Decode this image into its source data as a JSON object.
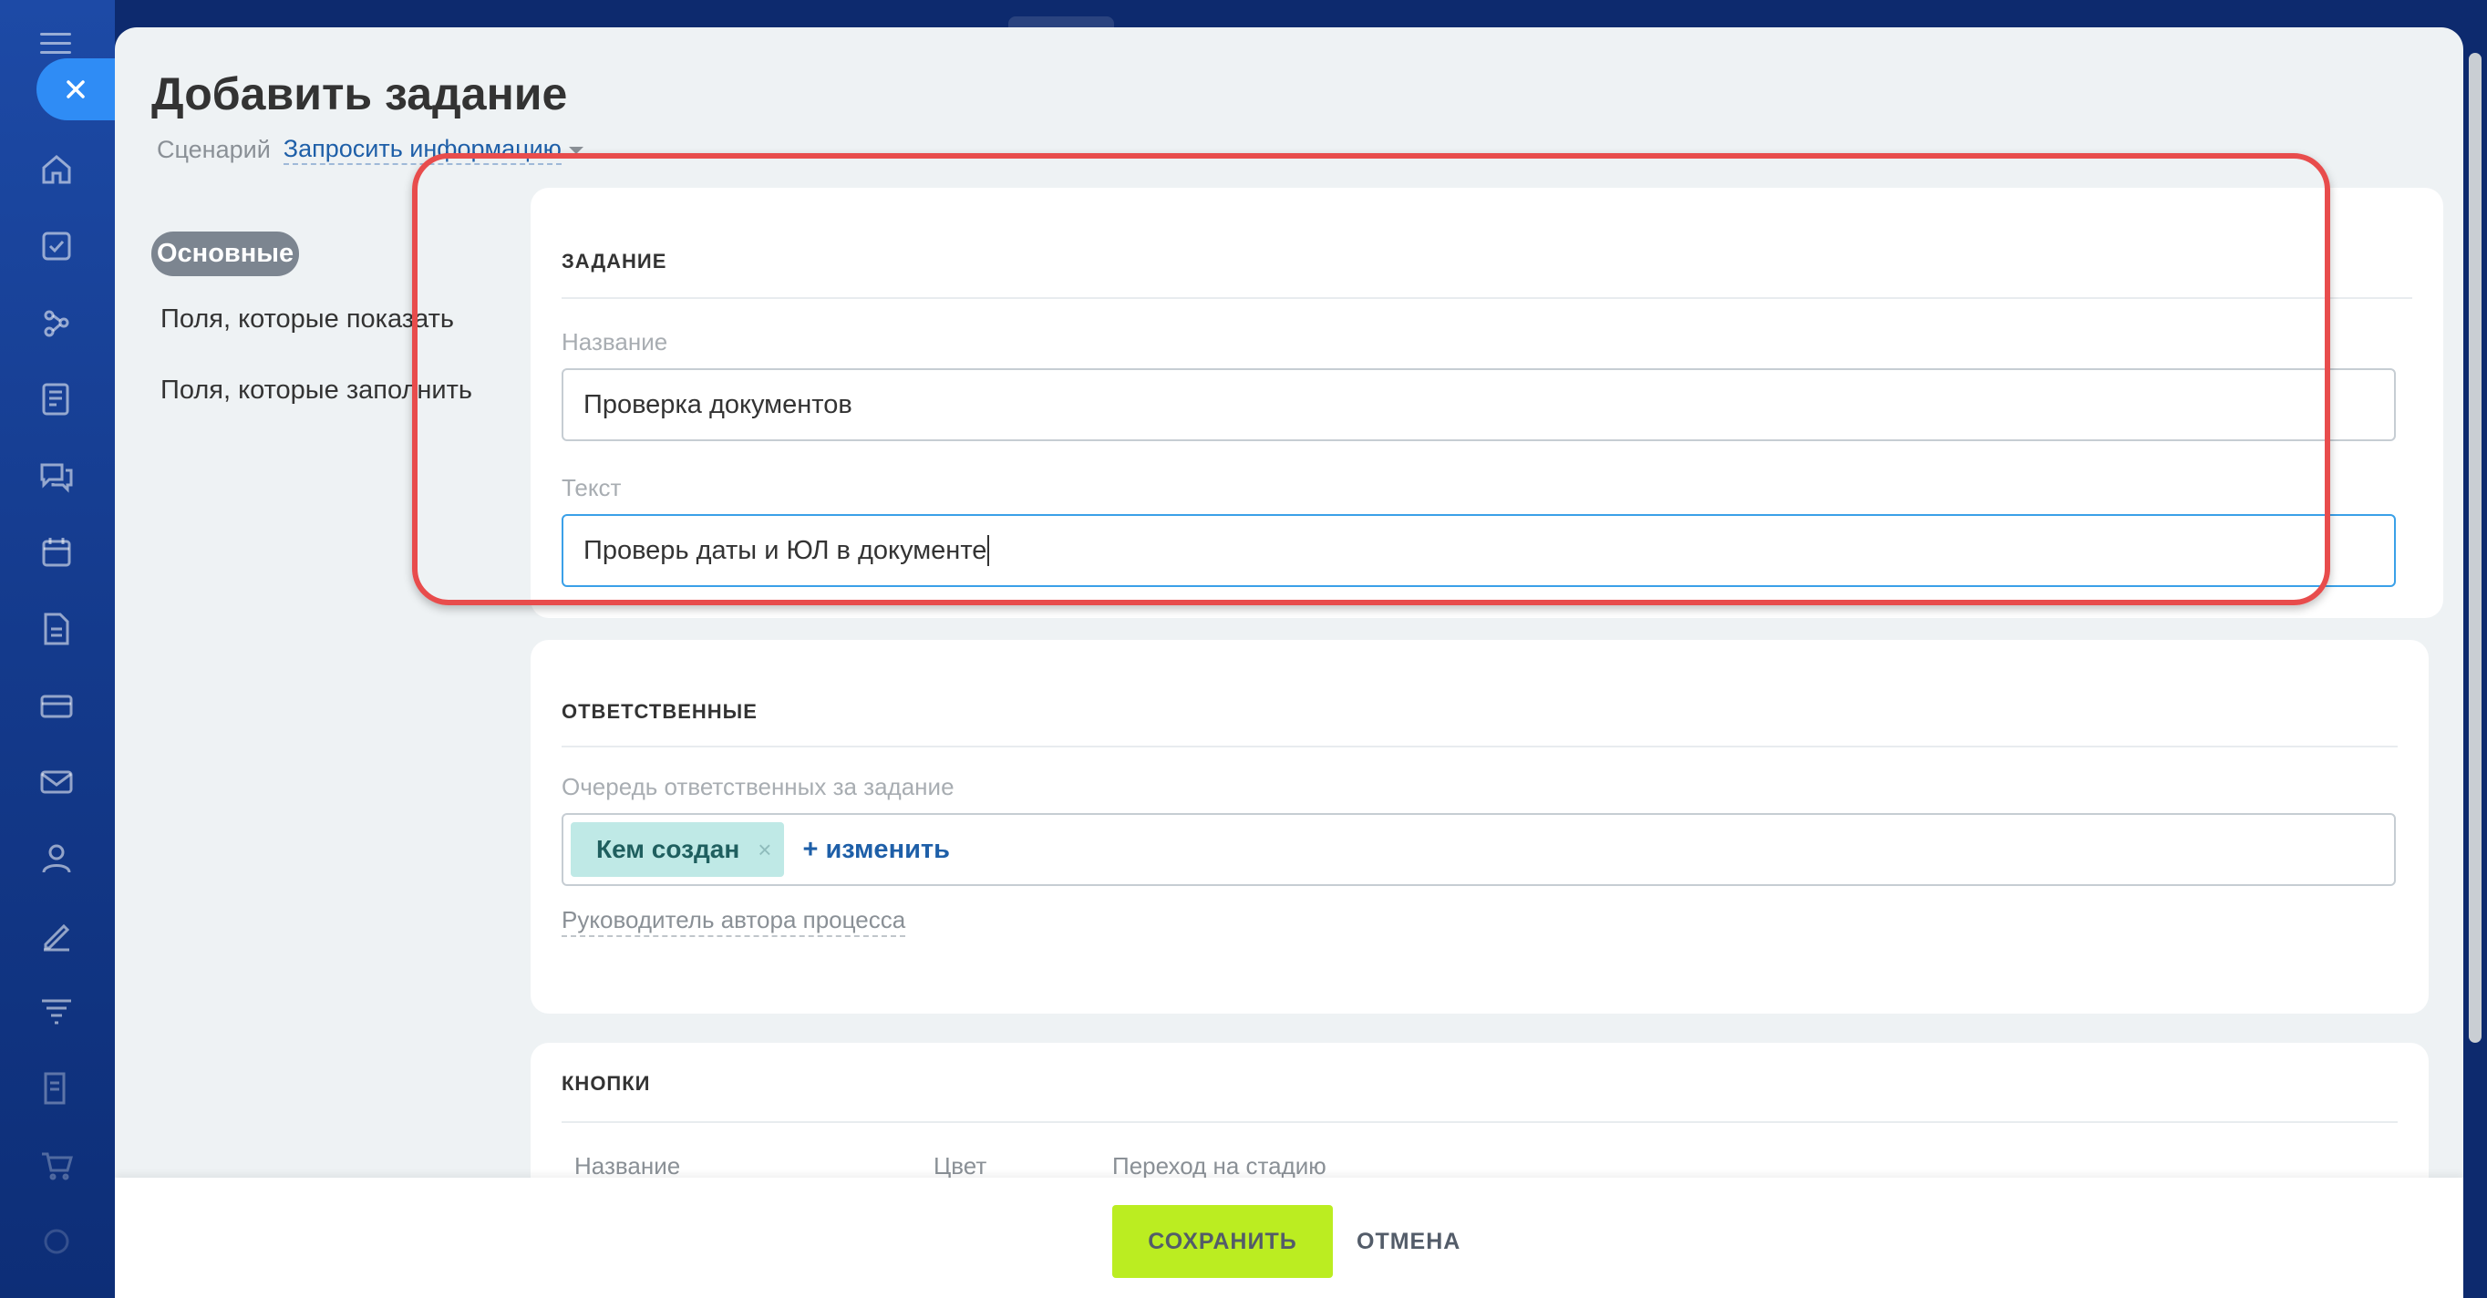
{
  "colors": {
    "accent_blue": "#2f8cf5",
    "save_green": "#bbed21",
    "highlight_red": "#e84c4c",
    "tag_teal": "#bfe9e6"
  },
  "rail": {
    "icons": [
      "menu-icon",
      "home-icon",
      "tasks-icon",
      "crm-icon",
      "feed-icon",
      "chat-icon",
      "calendar-icon",
      "documents-icon",
      "inventory-icon",
      "mail-icon",
      "contacts-icon",
      "sign-icon",
      "funnel-icon",
      "forms-icon",
      "shop-icon",
      "more-icon"
    ]
  },
  "page": {
    "title": "Добавить задание",
    "scenario_label": "Сценарий",
    "scenario_value": "Запросить информацию"
  },
  "nav": {
    "items": [
      {
        "label": "Основные",
        "active": true
      },
      {
        "label": "Поля, которые показать",
        "active": false
      },
      {
        "label": "Поля, которые заполнить",
        "active": false
      }
    ]
  },
  "task": {
    "section_title": "ЗАДАНИЕ",
    "name_label": "Название",
    "name_value": "Проверка документов",
    "text_label": "Текст",
    "text_value": "Проверь даты и ЮЛ в документе"
  },
  "responsible": {
    "section_title": "ОТВЕТСТВЕННЫЕ",
    "queue_label": "Очередь ответственных за задание",
    "tag": "Кем создан",
    "tag_remove": "×",
    "change_link": "+ изменить",
    "manager_link": "Руководитель автора процесса"
  },
  "buttons_section": {
    "section_title": "КНОПКИ",
    "columns": [
      "Название",
      "Цвет",
      "Переход на стадию"
    ]
  },
  "footer": {
    "save": "СОХРАНИТЬ",
    "cancel": "ОТМЕНА"
  }
}
